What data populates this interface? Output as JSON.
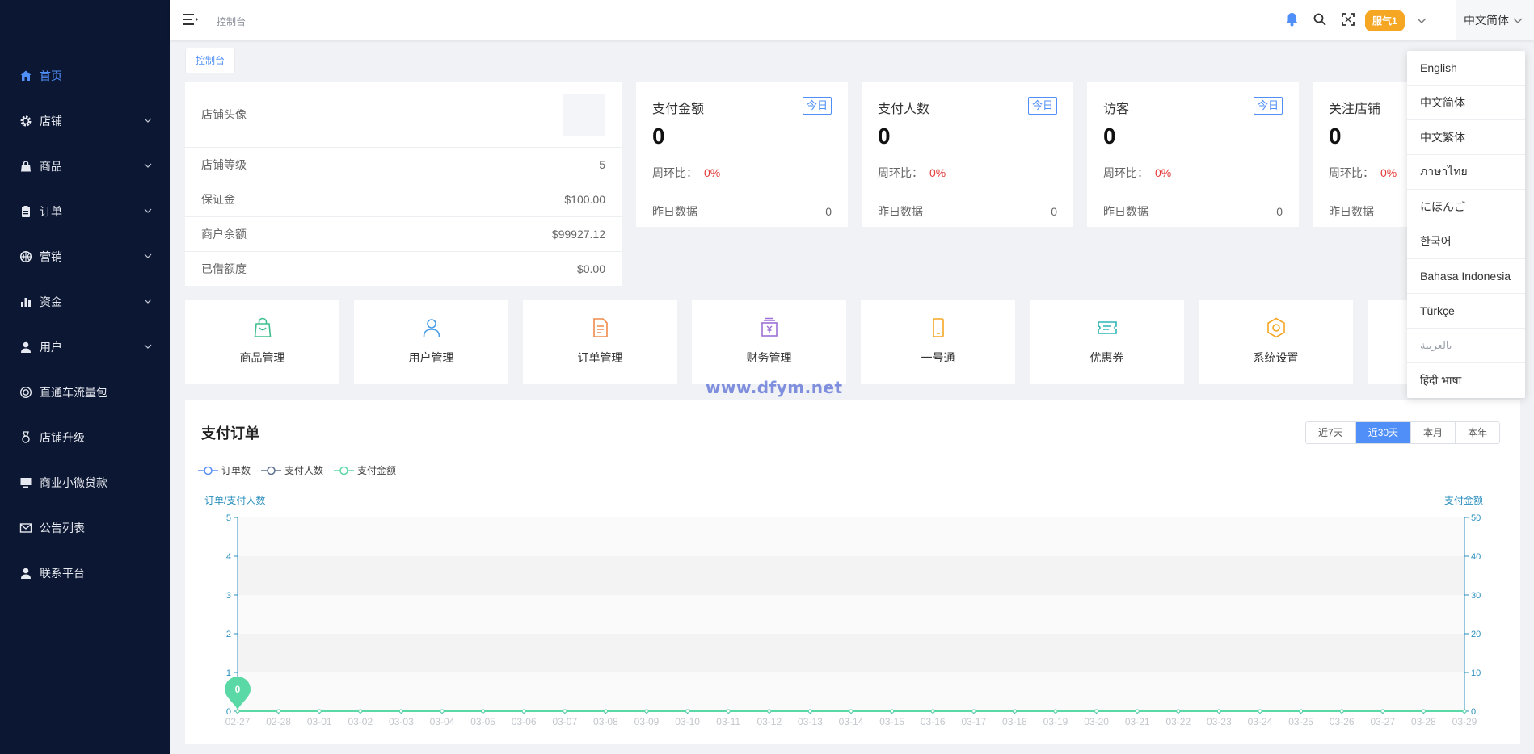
{
  "sidebar": {
    "items": [
      {
        "label": "首页",
        "icon": "home-icon",
        "active": true,
        "has_children": false
      },
      {
        "label": "店铺",
        "icon": "gear-icon",
        "has_children": true
      },
      {
        "label": "商品",
        "icon": "bag-icon",
        "has_children": true
      },
      {
        "label": "订单",
        "icon": "clipboard-icon",
        "has_children": true
      },
      {
        "label": "营销",
        "icon": "basketball-icon",
        "has_children": true
      },
      {
        "label": "资金",
        "icon": "bar-chart-icon",
        "has_children": true
      },
      {
        "label": "用户",
        "icon": "user-icon",
        "has_children": true
      },
      {
        "label": "直通车流量包",
        "icon": "target-icon",
        "has_children": false
      },
      {
        "label": "店铺升级",
        "icon": "medal-icon",
        "has_children": false
      },
      {
        "label": "商业小微贷款",
        "icon": "monitor-icon",
        "has_children": false
      },
      {
        "label": "公告列表",
        "icon": "mail-icon",
        "has_children": false
      },
      {
        "label": "联系平台",
        "icon": "contact-icon",
        "has_children": false
      }
    ]
  },
  "header": {
    "breadcrumb": "控制台",
    "user_badge": "服气1",
    "language": "中文简体"
  },
  "tab": {
    "label": "控制台"
  },
  "store": {
    "avatar_label": "店铺头像",
    "rows": [
      {
        "label": "店铺等级",
        "value": "5"
      },
      {
        "label": "保证金",
        "value": "$100.00"
      },
      {
        "label": "商户余额",
        "value": "$99927.12"
      },
      {
        "label": "已借额度",
        "value": "$0.00"
      }
    ]
  },
  "stats": [
    {
      "title": "支付金额",
      "tag": "今日",
      "value": "0",
      "ratio_label": "周环比：",
      "ratio": "0%",
      "yesterday_label": "昨日数据",
      "yesterday": "0"
    },
    {
      "title": "支付人数",
      "tag": "今日",
      "value": "0",
      "ratio_label": "周环比：",
      "ratio": "0%",
      "yesterday_label": "昨日数据",
      "yesterday": "0"
    },
    {
      "title": "访客",
      "tag": "今日",
      "value": "0",
      "ratio_label": "周环比：",
      "ratio": "0%",
      "yesterday_label": "昨日数据",
      "yesterday": "0"
    },
    {
      "title": "关注店铺",
      "tag": "",
      "value": "0",
      "ratio_label": "周环比：",
      "ratio": "0%",
      "yesterday_label": "昨日数据",
      "yesterday": ""
    }
  ],
  "shortcuts": [
    {
      "label": "商品管理",
      "icon": "shopping-bag-icon",
      "color": "#3fbf8f"
    },
    {
      "label": "用户管理",
      "icon": "user-icon",
      "color": "#4a9fe8"
    },
    {
      "label": "订单管理",
      "icon": "document-icon",
      "color": "#f08a4b"
    },
    {
      "label": "财务管理",
      "icon": "finance-icon",
      "color": "#9b6fd6"
    },
    {
      "label": "一号通",
      "icon": "phone-icon",
      "color": "#f5a623"
    },
    {
      "label": "优惠券",
      "icon": "coupon-icon",
      "color": "#2fb5b5"
    },
    {
      "label": "系统设置",
      "icon": "settings-hex-icon",
      "color": "#f5a623"
    },
    {
      "label": "",
      "icon": "",
      "color": "#ffffff"
    }
  ],
  "watermark": "www.dfym.net",
  "chart": {
    "title": "支付订单",
    "ranges": [
      {
        "label": "近7天",
        "active": false
      },
      {
        "label": "近30天",
        "active": true
      },
      {
        "label": "本月",
        "active": false
      },
      {
        "label": "本年",
        "active": false
      }
    ],
    "legend": [
      {
        "name": "订单数",
        "color": "#5b8ff9"
      },
      {
        "name": "支付人数",
        "color": "#5d7092"
      },
      {
        "name": "支付金额",
        "color": "#5ad8a6"
      }
    ],
    "left_axis_label": "订单/支付人数",
    "right_axis_label": "支付金额",
    "marker_value": "0"
  },
  "chart_data": {
    "type": "line",
    "x": [
      "02-27",
      "02-28",
      "03-01",
      "03-02",
      "03-03",
      "03-04",
      "03-05",
      "03-06",
      "03-07",
      "03-08",
      "03-09",
      "03-10",
      "03-11",
      "03-12",
      "03-13",
      "03-14",
      "03-15",
      "03-16",
      "03-17",
      "03-18",
      "03-19",
      "03-20",
      "03-21",
      "03-22",
      "03-23",
      "03-24",
      "03-25",
      "03-26",
      "03-27",
      "03-28",
      "03-29"
    ],
    "series": [
      {
        "name": "订单数",
        "axis": "left",
        "values": [
          0,
          0,
          0,
          0,
          0,
          0,
          0,
          0,
          0,
          0,
          0,
          0,
          0,
          0,
          0,
          0,
          0,
          0,
          0,
          0,
          0,
          0,
          0,
          0,
          0,
          0,
          0,
          0,
          0,
          0,
          0
        ]
      },
      {
        "name": "支付人数",
        "axis": "left",
        "values": [
          0,
          0,
          0,
          0,
          0,
          0,
          0,
          0,
          0,
          0,
          0,
          0,
          0,
          0,
          0,
          0,
          0,
          0,
          0,
          0,
          0,
          0,
          0,
          0,
          0,
          0,
          0,
          0,
          0,
          0,
          0
        ]
      },
      {
        "name": "支付金额",
        "axis": "right",
        "values": [
          0,
          0,
          0,
          0,
          0,
          0,
          0,
          0,
          0,
          0,
          0,
          0,
          0,
          0,
          0,
          0,
          0,
          0,
          0,
          0,
          0,
          0,
          0,
          0,
          0,
          0,
          0,
          0,
          0,
          0,
          0
        ]
      }
    ],
    "y_left": {
      "label": "订单/支付人数",
      "range": [
        0,
        5
      ],
      "ticks": [
        0,
        1,
        2,
        3,
        4,
        5
      ]
    },
    "y_right": {
      "label": "支付金额",
      "range": [
        0,
        50
      ],
      "ticks": [
        0,
        10,
        20,
        30,
        40,
        50
      ]
    },
    "grid": true,
    "legend_position": "top-left"
  },
  "language_menu": {
    "items": [
      "English",
      "中文简体",
      "中文繁体",
      "ภาษาไทย",
      "にほんご",
      "한국어",
      "Bahasa Indonesia",
      "Türkçe",
      "بالعربية",
      "हिंदी भाषा"
    ]
  }
}
